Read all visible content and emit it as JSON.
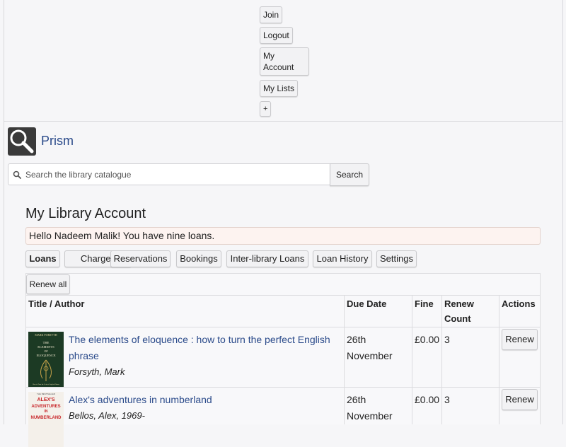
{
  "topnav": {
    "join": "Join",
    "logout": "Logout",
    "my_account_line1": "My",
    "my_account_line2": "Account",
    "my_lists": "My Lists",
    "plus": "+"
  },
  "brand": {
    "name": "Prism"
  },
  "search": {
    "placeholder": "Search the library catalogue",
    "button": "Search"
  },
  "page": {
    "title": "My Library Account",
    "greeting": "Hello Nadeem Malik! You have nine loans."
  },
  "tabs": [
    "Loans",
    "Charges",
    "Reservations",
    "Bookings",
    "Inter-library Loans",
    "Loan History",
    "Settings"
  ],
  "active_tab": "Loans",
  "loans": {
    "renew_all": "Renew all",
    "headers": {
      "title_author": "Title / Author",
      "due_date": "Due Date",
      "fine": "Fine",
      "renew_line1": "Renew",
      "renew_line2": "Count",
      "actions": "Actions"
    },
    "rows": [
      {
        "title": "The elements of eloquence : how to turn the perfect English phrase",
        "author": "Forsyth, Mark",
        "due_line1": "26th",
        "due_line2": "November",
        "fine": "£0.00",
        "renew_count": "3",
        "action": "Renew",
        "cover_text": {
          "top": "MARK FORSYTH",
          "a": "THE",
          "b": "ELEMENTS",
          "c": "OF",
          "d": "ELOQUENCE",
          "sub": "How to Turn the Perfect English Phrase"
        }
      },
      {
        "title": "Alex's adventures in numberland",
        "author": "Bellos, Alex, 1969-",
        "due_line1": "26th",
        "due_line2": "November",
        "fine": "£0.00",
        "renew_count": "3",
        "action": "Renew",
        "cover_text": {
          "top": "THE BESTSELLER",
          "a": "ALEX'S",
          "b": "ADVENTURES",
          "c": "IN",
          "d": "NUMBERLAND"
        }
      }
    ]
  }
}
